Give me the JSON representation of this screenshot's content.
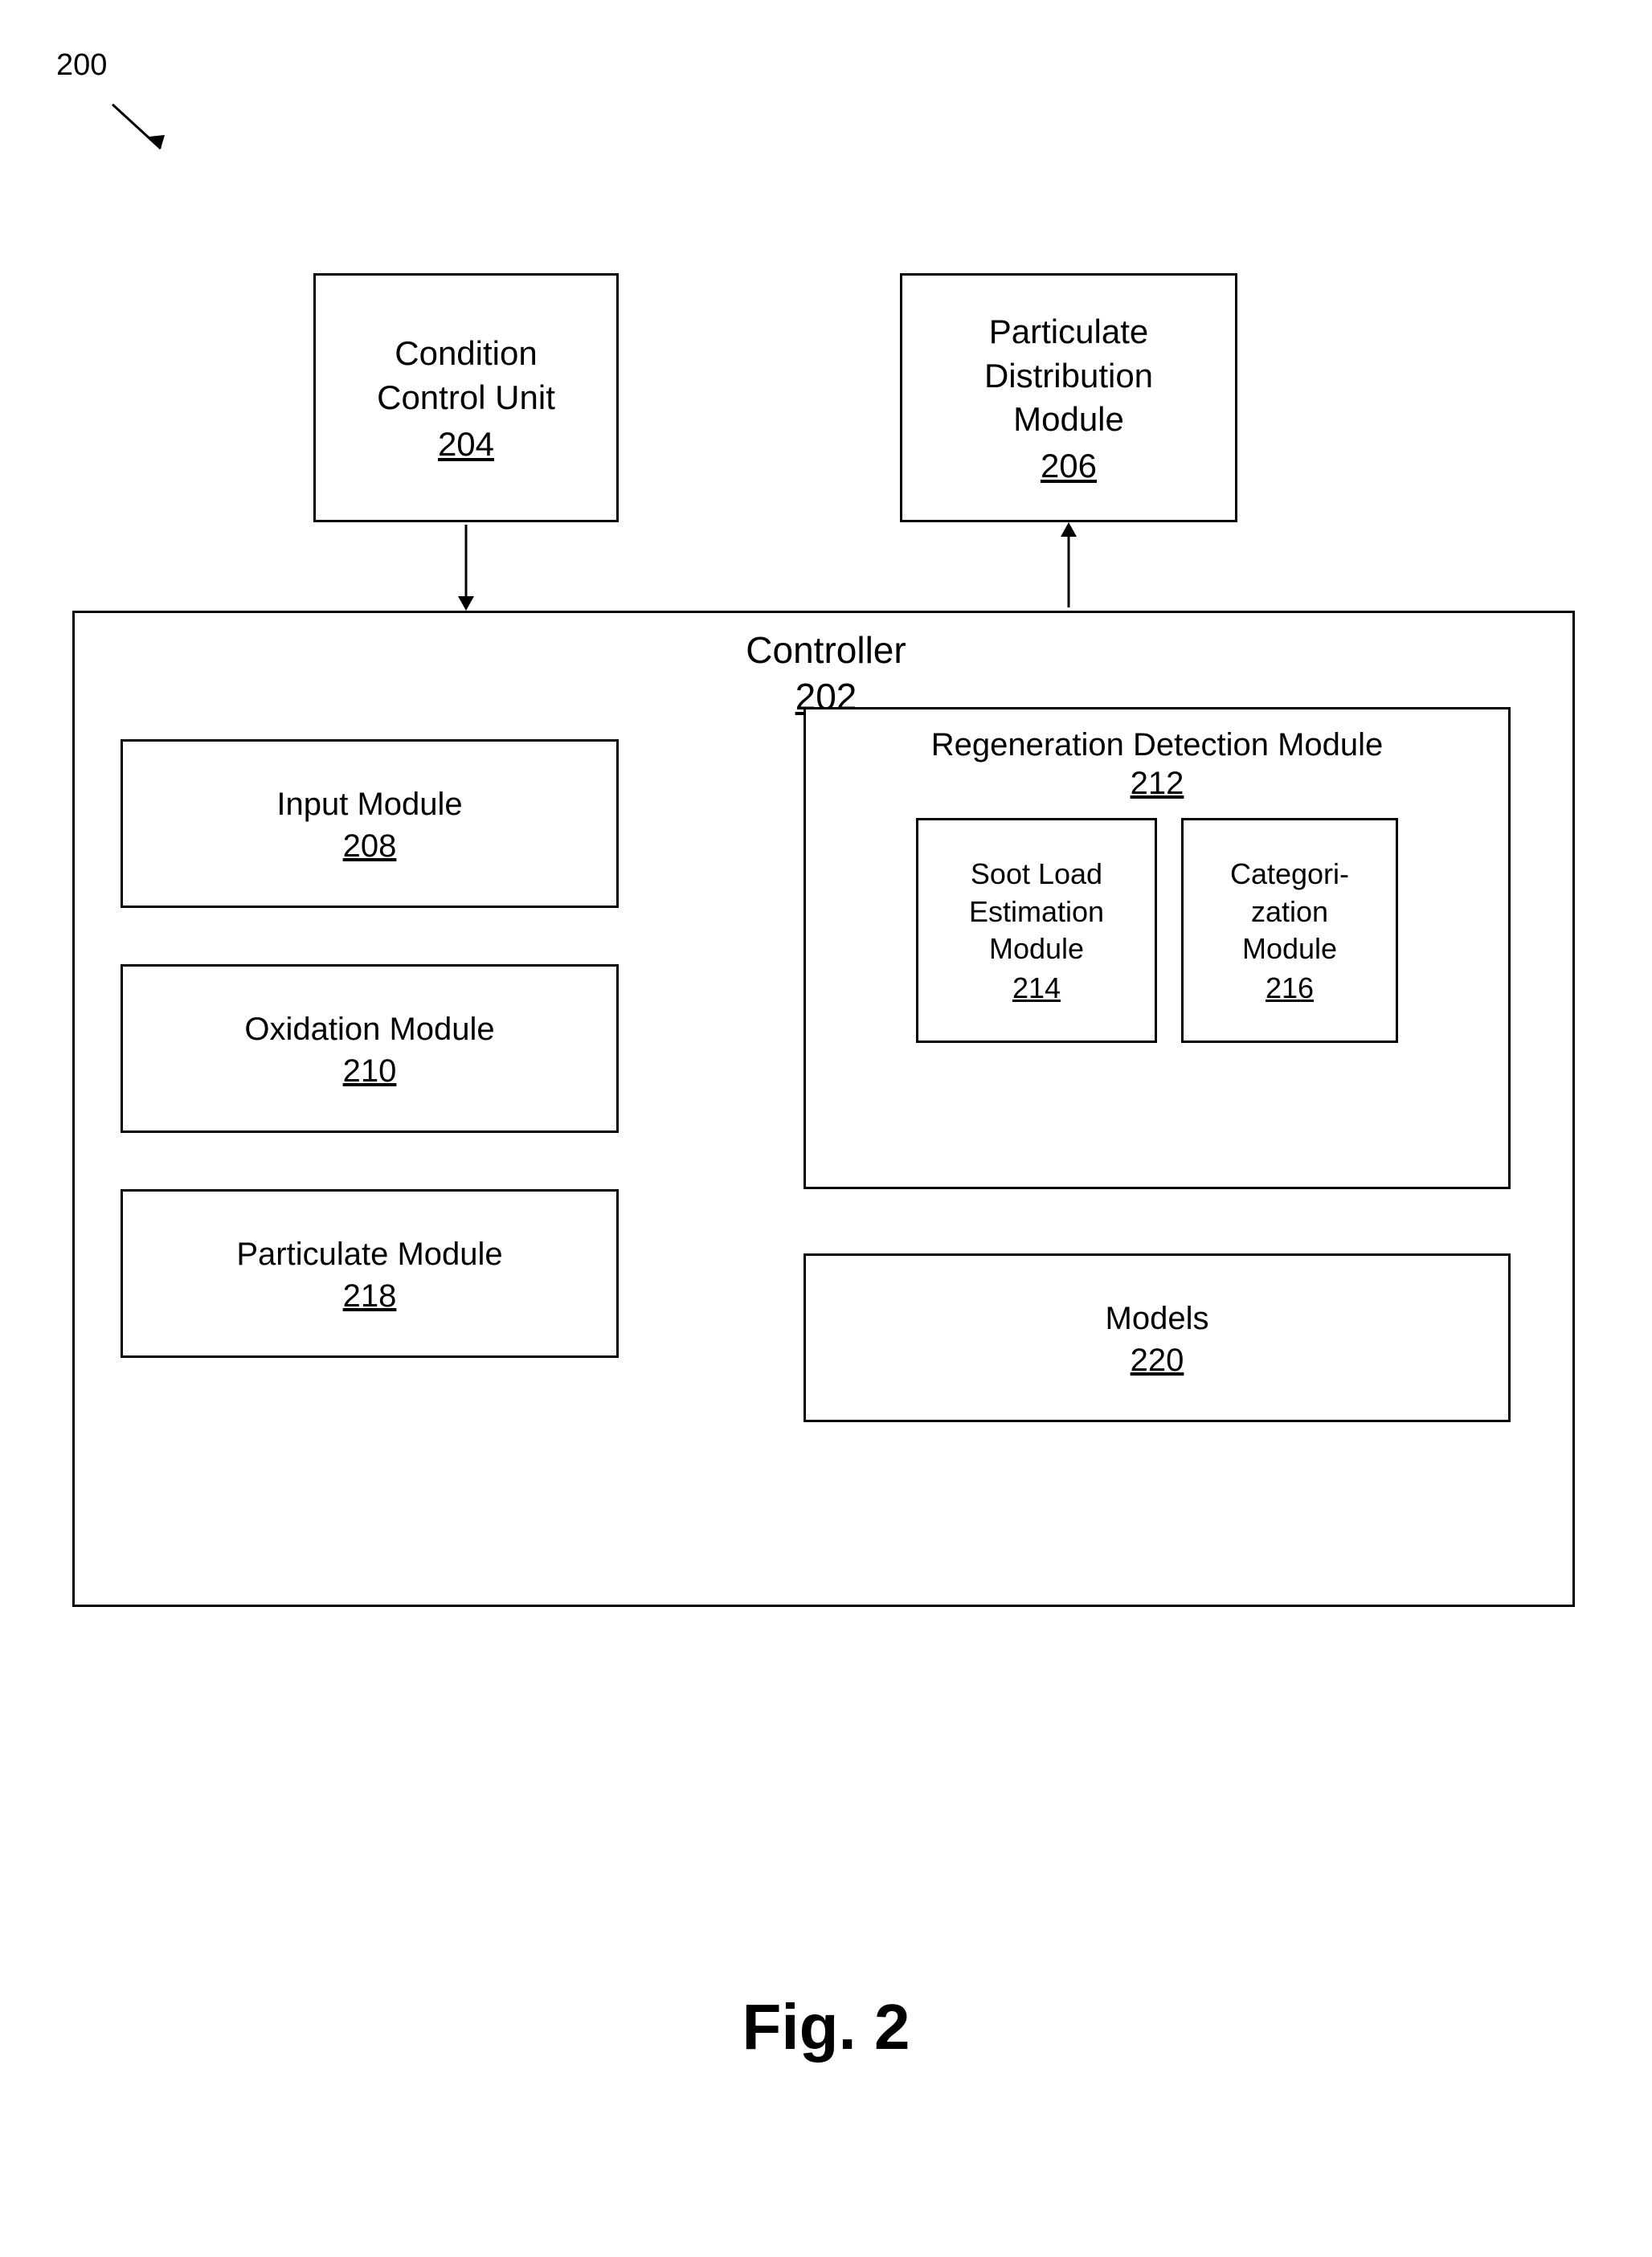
{
  "diagram": {
    "ref_label": "200",
    "top_left_box": {
      "title": "Condition\nControl Unit",
      "number": "204"
    },
    "top_right_box": {
      "title": "Particulate\nDistribution\nModule",
      "number": "206"
    },
    "controller_box": {
      "label": "Controller",
      "number": "202",
      "modules": [
        {
          "title": "Input Module",
          "number": "208"
        },
        {
          "title": "Oxidation Module",
          "number": "210"
        },
        {
          "title": "Particulate Module",
          "number": "218"
        }
      ],
      "rdm": {
        "title": "Regeneration Detection\nModule",
        "number": "212",
        "sub_modules": [
          {
            "title": "Soot Load\nEstimation\nModule",
            "number": "214"
          },
          {
            "title": "Categori-\nzation\nModule",
            "number": "216"
          }
        ]
      },
      "models": {
        "title": "Models",
        "number": "220"
      }
    }
  },
  "caption": "Fig. 2"
}
